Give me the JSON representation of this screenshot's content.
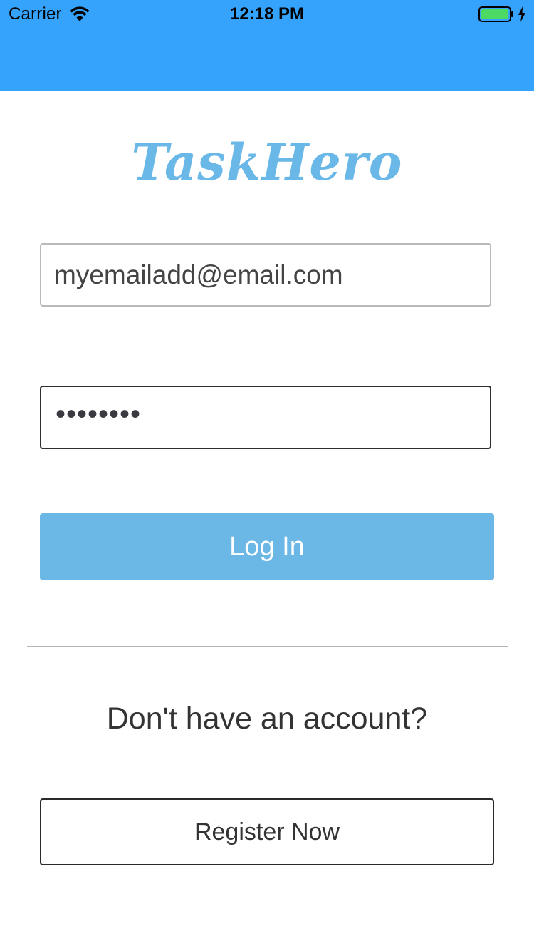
{
  "status_bar": {
    "carrier": "Carrier",
    "time": "12:18 PM"
  },
  "app": {
    "logo_text": "TaskHero"
  },
  "form": {
    "email_value": "myemailadd@email.com",
    "password_value": "••••••••"
  },
  "buttons": {
    "login_label": "Log In",
    "register_label": "Register Now"
  },
  "register_prompt": "Don't have an account?",
  "colors": {
    "nav_bar": "#35a2fb",
    "logo": "#6ab8e8",
    "login_button": "#6bb8e6",
    "battery": "#4cd964"
  },
  "icons": {
    "wifi": "wifi-icon",
    "battery": "battery-icon",
    "charging": "bolt-icon"
  }
}
